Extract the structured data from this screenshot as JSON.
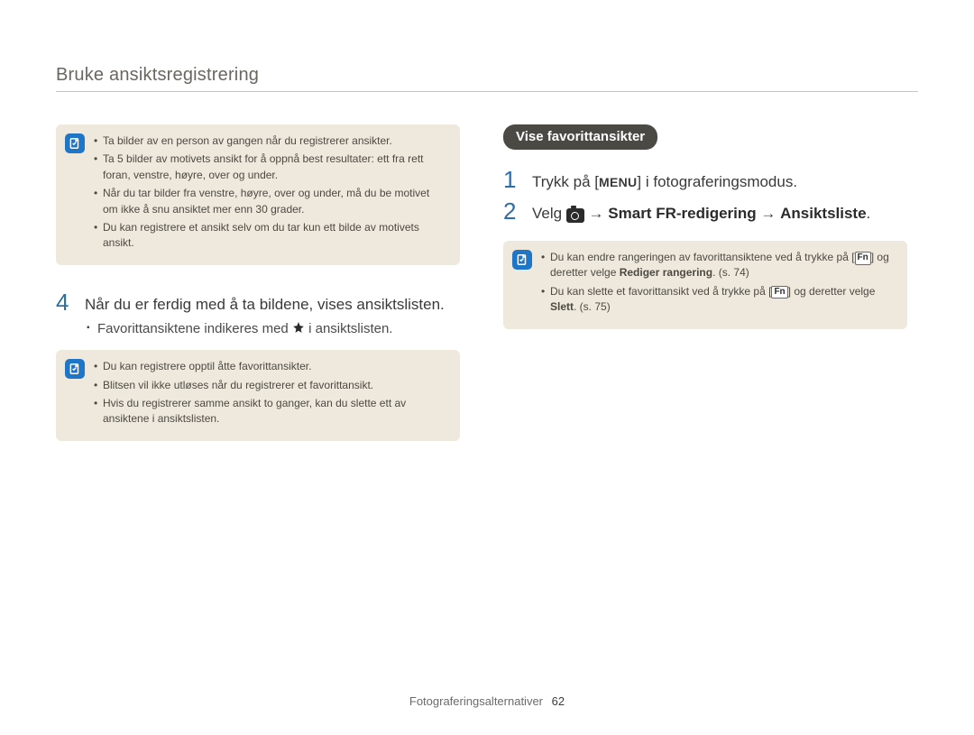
{
  "header": {
    "title": "Bruke ansiktsregistrering"
  },
  "left": {
    "noteA": {
      "items": [
        "Ta bilder av en person av gangen når du registrerer ansikter.",
        "Ta 5 bilder av motivets ansikt for å oppnå best resultater: ett fra rett foran, venstre, høyre, over og under.",
        "Når du tar bilder fra venstre, høyre, over og under, må du be motivet om ikke å snu ansiktet mer enn 30 grader.",
        "Du kan registrere et ansikt selv om du tar kun ett bilde av motivets ansikt."
      ]
    },
    "step4": {
      "num": "4",
      "text": "Når du er ferdig med å ta bildene, vises ansiktslisten.",
      "sub_pre": "Favorittansiktene indikeres med ",
      "sub_post": " i ansiktslisten."
    },
    "noteB": {
      "items": [
        "Du kan registrere opptil åtte favorittansikter.",
        "Blitsen vil ikke utløses når du registrerer et favorittansikt.",
        "Hvis du registrerer samme ansikt to ganger, kan du slette ett av ansiktene i ansiktslisten."
      ]
    }
  },
  "right": {
    "pill": "Vise favorittansikter",
    "step1": {
      "num": "1",
      "pre": "Trykk på [",
      "menu": "MENU",
      "post": "] i fotograferingsmodus."
    },
    "step2": {
      "num": "2",
      "pre": "Velg ",
      "arrow": " → ",
      "bold1": "Smart FR-redigering",
      "bold2": "Ansiktsliste",
      "period": "."
    },
    "noteC": {
      "item1_pre": "Du kan endre rangeringen av favorittansiktene ved å trykke på [",
      "fn": "Fn",
      "item1_mid": "] og deretter velge ",
      "item1_bold": "Rediger rangering",
      "item1_post": ". (s. 74)",
      "item2_pre": "Du kan slette et favorittansikt ved å trykke på [",
      "item2_mid": "] og deretter velge ",
      "item2_bold": "Slett",
      "item2_post": ". (s. 75)"
    }
  },
  "footer": {
    "section": "Fotograferingsalternativer",
    "page": "62"
  }
}
